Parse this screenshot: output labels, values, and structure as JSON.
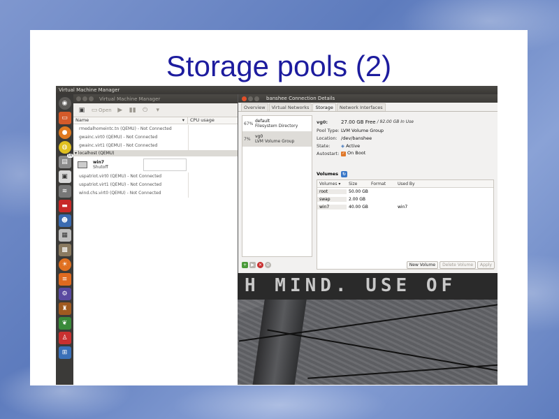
{
  "slide": {
    "title": "Storage pools (2)"
  },
  "topbar": {
    "title": "Virtual Machine Manager"
  },
  "launcher": {
    "badge_count": "16"
  },
  "vmm": {
    "window_title": "Virtual Machine Manager",
    "toolbar": {
      "open_label": "Open"
    },
    "columns": {
      "name": "Name",
      "cpu": "CPU usage"
    },
    "connections_top": [
      "rmedalhomeintc.tn (QEMU) - Not Connected",
      "gwainc.virt0 (QEMU) - Not Connected",
      "gwainc.virt1 (QEMU) - Not Connected"
    ],
    "group_label": "localhost (QEMU)",
    "vm": {
      "name": "win7",
      "state": "Shutoff"
    },
    "connections_bottom": [
      "uspatriot.virt0 (QEMU) - Not Connected",
      "uspatriot.virt1 (QEMU) - Not Connected",
      "wind.chs.virt0 (QEMU) - Not Connected"
    ]
  },
  "details": {
    "window_title": "banshee Connection Details",
    "tabs": [
      "Overview",
      "Virtual Networks",
      "Storage",
      "Network Interfaces"
    ],
    "active_tab": "Storage",
    "pools": [
      {
        "pct": "67%",
        "name": "default",
        "type": "Filesystem Directory"
      },
      {
        "pct": "7%",
        "name": "vg0",
        "type": "LVM Volume Group"
      }
    ],
    "info": {
      "name_label": "vg0:",
      "free": "27.00 GB Free",
      "total": "/ 92.00 GB In Use",
      "pool_type_label": "Pool Type:",
      "pool_type": "LVM Volume Group",
      "location_label": "Location:",
      "location": "/dev/banshee",
      "state_label": "State:",
      "state": "Active",
      "autostart_label": "Autostart:",
      "autostart": "On Boot"
    },
    "volumes_label": "Volumes",
    "volume_columns": [
      "Volumes",
      "Size",
      "Format",
      "Used By"
    ],
    "volumes": [
      {
        "name": "root",
        "size": "50.00 GB",
        "format": "",
        "used_by": ""
      },
      {
        "name": "swap",
        "size": "2.00 GB",
        "format": "",
        "used_by": ""
      },
      {
        "name": "win7",
        "size": "40.00 GB",
        "format": "",
        "used_by": "win7"
      }
    ],
    "buttons": {
      "new_volume": "New Volume",
      "delete_volume": "Delete Volume",
      "apply": "Apply"
    }
  },
  "photo": {
    "wall_text": "H MIND. USE OF"
  }
}
